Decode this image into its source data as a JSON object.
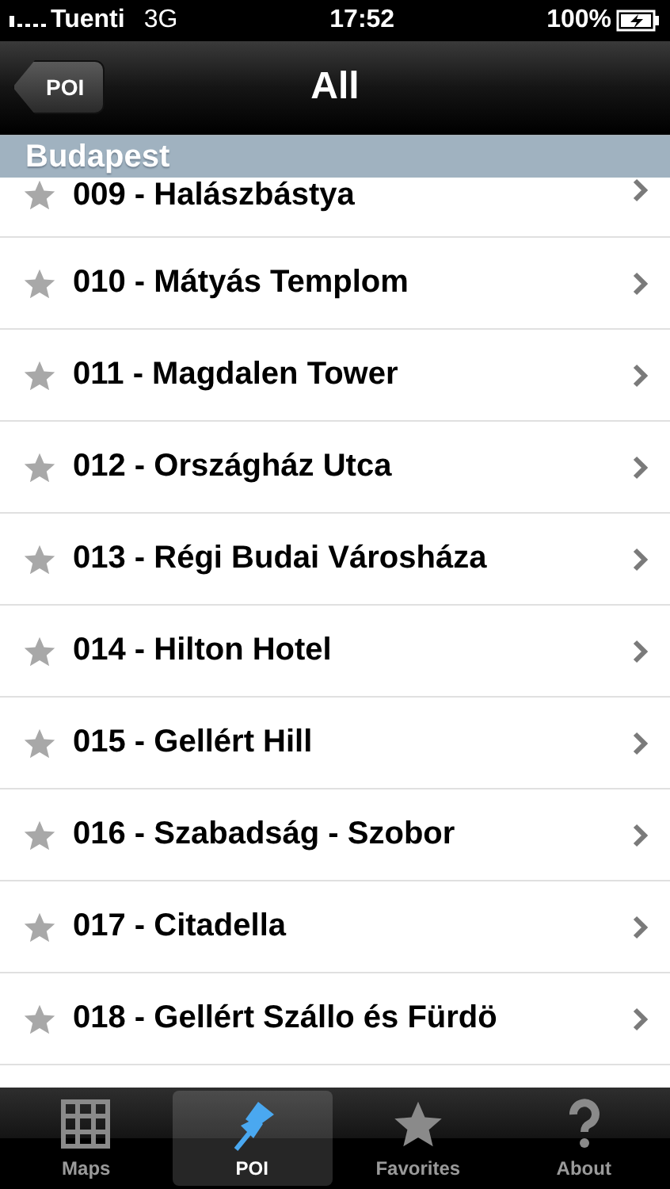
{
  "status_bar": {
    "carrier": "Tuenti",
    "network": "3G",
    "time": "17:52",
    "battery": "100%"
  },
  "nav_bar": {
    "back_button": "POI",
    "title": "All"
  },
  "section": {
    "header": "Budapest",
    "rows": [
      {
        "label": "009 - Halászbástya",
        "favorite": false
      },
      {
        "label": "010 - Mátyás Templom",
        "favorite": false
      },
      {
        "label": "011 - Magdalen Tower",
        "favorite": false
      },
      {
        "label": "012 - Országház Utca",
        "favorite": false
      },
      {
        "label": "013 - Régi Budai Városháza",
        "favorite": false
      },
      {
        "label": "014 - Hilton Hotel",
        "favorite": false
      },
      {
        "label": "015 - Gellért Hill",
        "favorite": false
      },
      {
        "label": "016 - Szabadság - Szobor",
        "favorite": false
      },
      {
        "label": "017 - Citadella",
        "favorite": false
      },
      {
        "label": "018 - Gellért Szállo és Fürdö",
        "favorite": false
      }
    ]
  },
  "tab_bar": [
    {
      "kind": "maps",
      "label": "Maps",
      "selected": false
    },
    {
      "kind": "pin",
      "label": "POI",
      "selected": true
    },
    {
      "kind": "star",
      "label": "Favorites",
      "selected": false
    },
    {
      "kind": "help",
      "label": "About",
      "selected": false
    }
  ]
}
